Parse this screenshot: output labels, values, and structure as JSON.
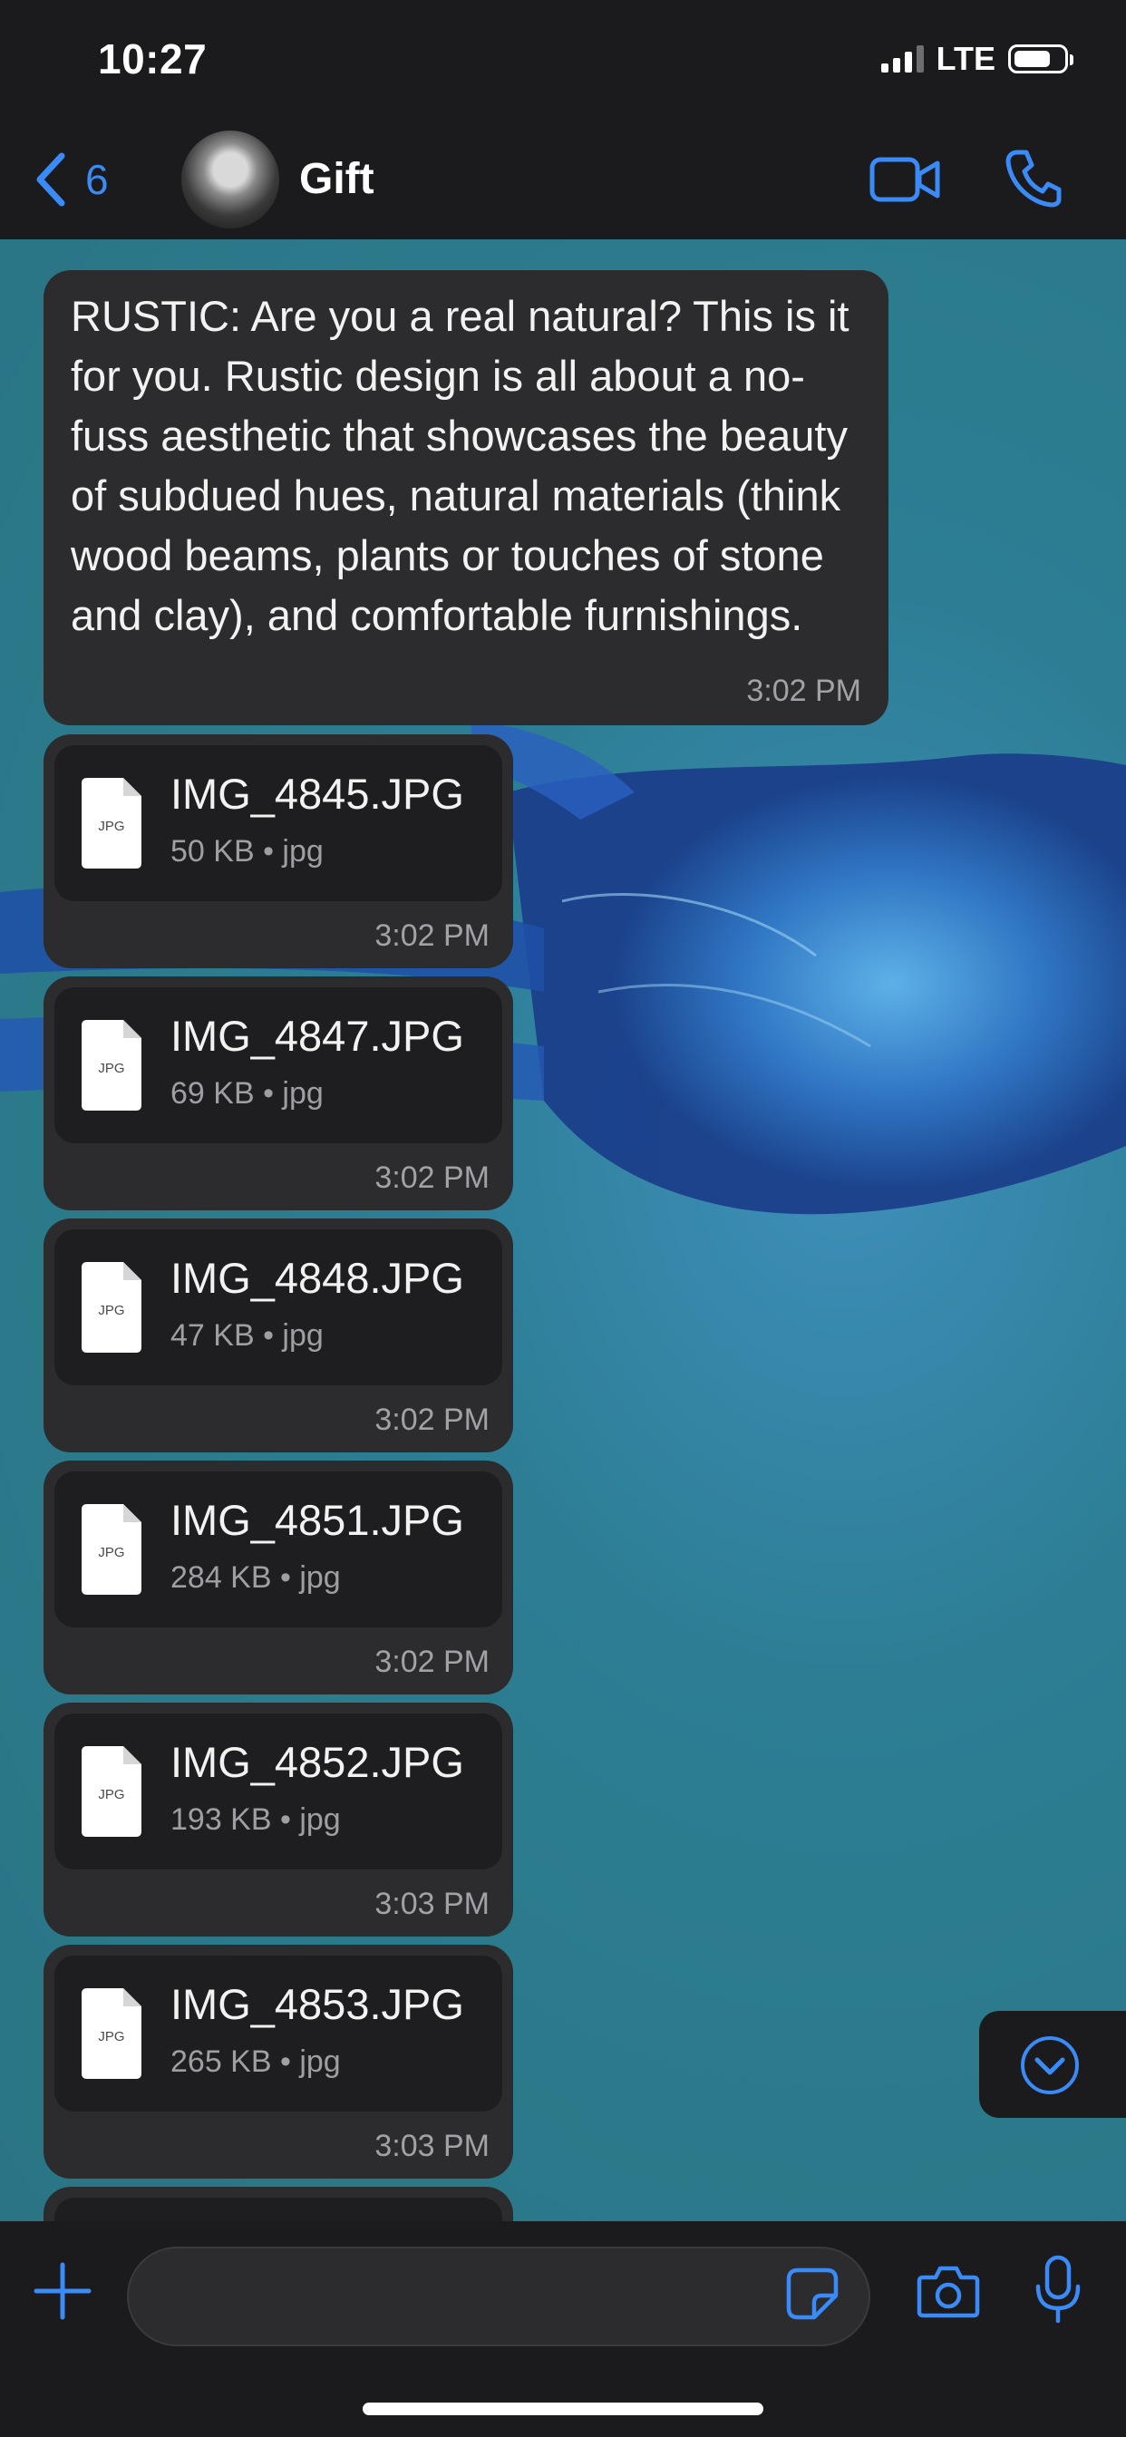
{
  "status": {
    "time": "10:27",
    "network": "LTE",
    "battery_percent": 75
  },
  "header": {
    "back_count": "6",
    "contact_name": "Gift"
  },
  "colors": {
    "accent": "#3a8bf7",
    "bubble": "#2c2c2e",
    "wallpaper": "#2b7b8c"
  },
  "messages": {
    "text": {
      "body": "RUSTIC: Are you a real natural? This is it for you. Rustic design is all about a no-fuss aesthetic that showcases the beauty of subdued hues, natural materials (think wood beams, plants or touches of stone and clay), and comfortable furnishings.",
      "time": "3:02 PM"
    },
    "files": [
      {
        "icon_label": "JPG",
        "name": "IMG_4845.JPG",
        "meta": "50 KB • jpg",
        "time": "3:02 PM"
      },
      {
        "icon_label": "JPG",
        "name": "IMG_4847.JPG",
        "meta": "69 KB • jpg",
        "time": "3:02 PM"
      },
      {
        "icon_label": "JPG",
        "name": "IMG_4848.JPG",
        "meta": "47 KB • jpg",
        "time": "3:02 PM"
      },
      {
        "icon_label": "JPG",
        "name": "IMG_4851.JPG",
        "meta": "284 KB • jpg",
        "time": "3:02 PM"
      },
      {
        "icon_label": "JPG",
        "name": "IMG_4852.JPG",
        "meta": "193 KB • jpg",
        "time": "3:03 PM"
      },
      {
        "icon_label": "JPG",
        "name": "IMG_4853.JPG",
        "meta": "265 KB • jpg",
        "time": "3:03 PM"
      }
    ]
  },
  "composer": {
    "value": "",
    "placeholder": ""
  },
  "icons": {
    "back": "chevron-left-icon",
    "video": "video-camera-icon",
    "call": "phone-icon",
    "scroll": "chevron-down-circle-icon",
    "attach": "plus-icon",
    "sticker": "sticker-icon",
    "camera": "camera-icon",
    "mic": "microphone-icon"
  }
}
